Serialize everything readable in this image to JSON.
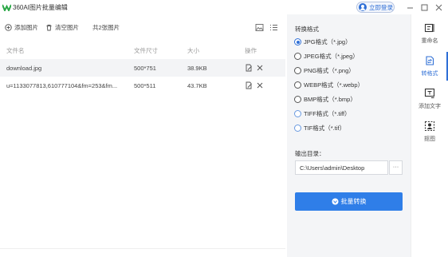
{
  "window": {
    "title": "360AI图片批量编辑",
    "login_label": "立即登录",
    "minimize": "—",
    "maximize": "☐",
    "close": "✕"
  },
  "toolbar": {
    "add_images": "添加图片",
    "clear_images": "清空图片",
    "image_count": "共2张图片",
    "icons": [
      "image-view-icon",
      "list-view-icon"
    ]
  },
  "table": {
    "headers": [
      "文件名",
      "文件尺寸",
      "大小",
      "操作"
    ],
    "rows": [
      {
        "name": "download.jpg",
        "dimensions": "500*751",
        "size": "38.9KB"
      },
      {
        "name": "u=1133077813,610777104&fm=253&fm...",
        "dimensions": "500*511",
        "size": "43.7KB"
      }
    ]
  },
  "convert": {
    "format_label": "转换格式",
    "formats": [
      {
        "label": "JPG格式（*.jpg）",
        "selected": true
      },
      {
        "label": "JPEG格式（*.jpeg）",
        "selected": false
      },
      {
        "label": "PNG格式（*.png）",
        "selected": false
      },
      {
        "label": "WEBP格式（*.webp）",
        "selected": false
      },
      {
        "label": "BMP格式（*.bmp）",
        "selected": false
      },
      {
        "label": "TIFF格式（*.tiff）",
        "selected": false
      },
      {
        "label": "TIF格式（*.tif）",
        "selected": false
      }
    ],
    "output_label": "输出目录：",
    "output_dir": "C:\\Users\\admin\\Desktop",
    "browse_label": "···",
    "button_label": "批量转换"
  },
  "sidebar": {
    "items": [
      {
        "label": "重命名",
        "icon": "rename-icon",
        "active": false
      },
      {
        "label": "转格式",
        "icon": "convert-format-icon",
        "active": true
      },
      {
        "label": "添加文字",
        "icon": "add-text-icon",
        "active": false
      },
      {
        "label": "抠图",
        "icon": "cutout-icon",
        "active": false
      }
    ]
  },
  "colors": {
    "accent": "#2f6fd6",
    "button": "#2f7ee8",
    "panel_bg": "#f4f5f7",
    "row_shade": "#f3f4f6"
  }
}
